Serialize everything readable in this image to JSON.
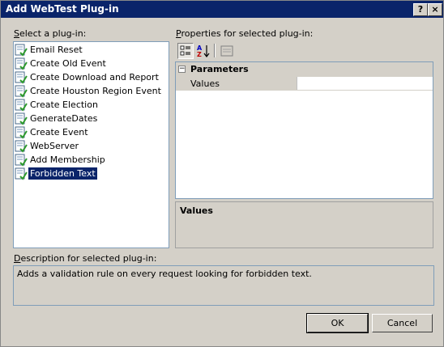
{
  "window": {
    "title": "Add WebTest Plug-in",
    "help_glyph": "?",
    "close_glyph": "×"
  },
  "plugin_list": {
    "label_accel": "S",
    "label_rest": "elect a plug-in:",
    "items": [
      {
        "label": "Email Reset",
        "selected": false
      },
      {
        "label": "Create Old Event",
        "selected": false
      },
      {
        "label": "Create Download and Report",
        "selected": false
      },
      {
        "label": "Create Houston Region Event",
        "selected": false
      },
      {
        "label": "Create Election",
        "selected": false
      },
      {
        "label": "GenerateDates",
        "selected": false
      },
      {
        "label": "Create Event",
        "selected": false
      },
      {
        "label": "WebServer",
        "selected": false
      },
      {
        "label": "Add Membership",
        "selected": false
      },
      {
        "label": "Forbidden Text",
        "selected": true
      }
    ]
  },
  "properties": {
    "label_accel": "P",
    "label_rest": "roperties for selected plug-in:",
    "toolbar": [
      {
        "name": "categorized-view",
        "pressed": true
      },
      {
        "name": "alphabetical-sort",
        "pressed": false
      },
      {
        "name": "property-pages",
        "pressed": false
      }
    ],
    "category": {
      "name": "Parameters",
      "expander_glyph": "⊟"
    },
    "rows": [
      {
        "name": "Values",
        "value": ""
      }
    ],
    "help_title": "Values"
  },
  "description": {
    "label_accel": "D",
    "label_rest": "escription for selected plug-in:",
    "text": "Adds a validation rule on every request looking for forbidden text."
  },
  "buttons": {
    "ok": "OK",
    "cancel": "Cancel"
  },
  "colors": {
    "title_bar": "#0a246a",
    "selection": "#0a246a",
    "dialog_bg": "#d4d0c8"
  }
}
